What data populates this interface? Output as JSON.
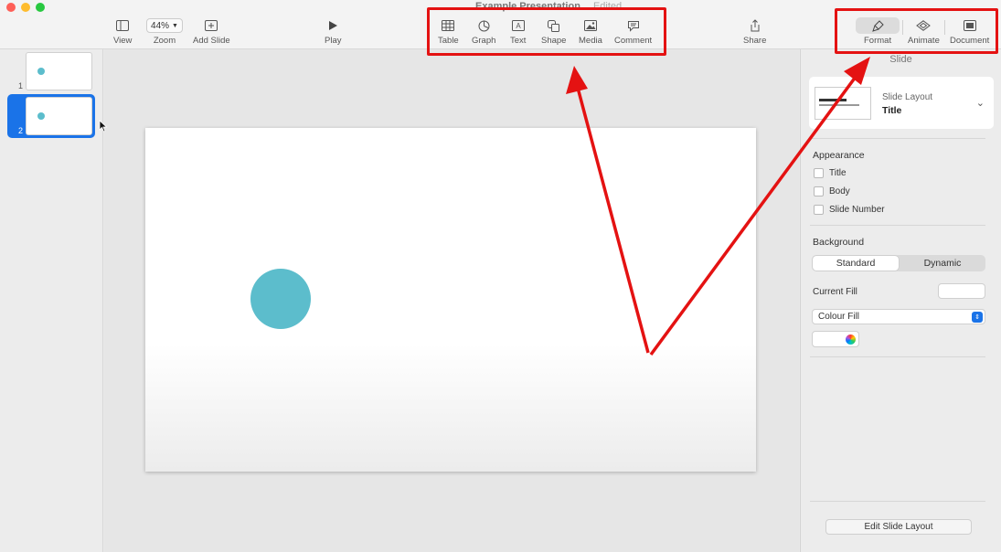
{
  "window": {
    "doc_name": "Example Presentation",
    "doc_status": "Edited"
  },
  "toolbar": {
    "view": "View",
    "zoom_value": "44%",
    "zoom": "Zoom",
    "add_slide": "Add Slide",
    "play": "Play",
    "table": "Table",
    "graph": "Graph",
    "text": "Text",
    "shape": "Shape",
    "media": "Media",
    "comment": "Comment",
    "share": "Share",
    "format": "Format",
    "animate": "Animate",
    "document": "Document"
  },
  "sidebar": {
    "slides": [
      {
        "number": "1"
      },
      {
        "number": "2"
      }
    ]
  },
  "inspector": {
    "tab": "Slide",
    "layout_label": "Slide Layout",
    "layout_value": "Title",
    "appearance": "Appearance",
    "checkboxes": [
      "Title",
      "Body",
      "Slide Number"
    ],
    "background": "Background",
    "seg_standard": "Standard",
    "seg_dynamic": "Dynamic",
    "current_fill": "Current Fill",
    "fill_type": "Colour Fill",
    "edit_layout": "Edit Slide Layout"
  },
  "colors": {
    "accent": "#1a73e8",
    "shape": "#5cbdcc",
    "highlight": "#e41212"
  }
}
